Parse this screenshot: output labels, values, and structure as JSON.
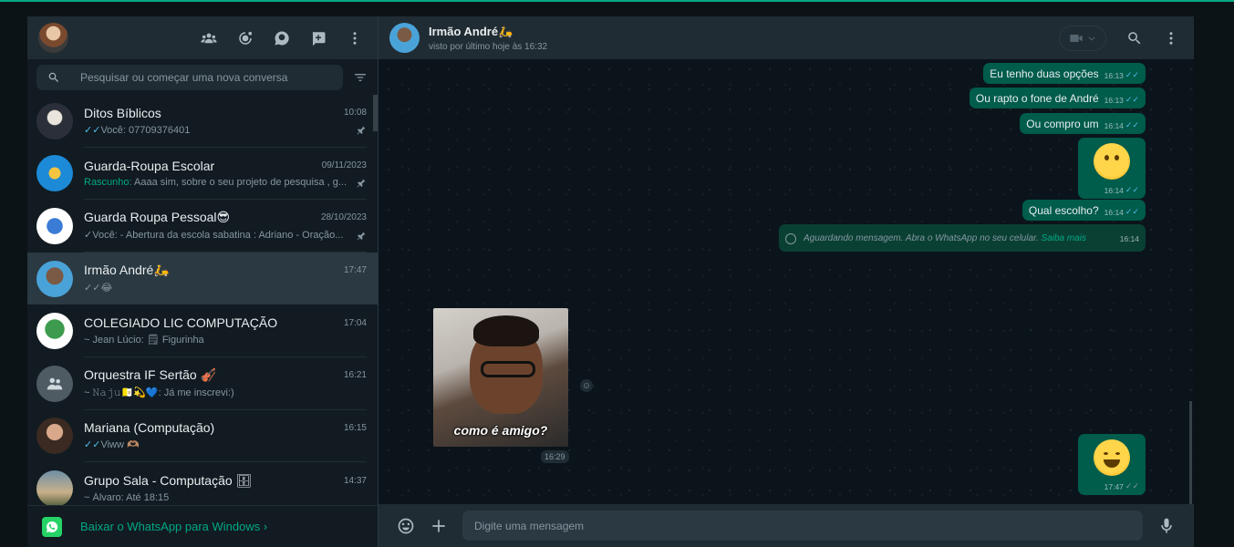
{
  "sidebar": {
    "search_placeholder": "Pesquisar ou começar uma nova conversa",
    "chats": [
      {
        "name": "Ditos Bíblicos",
        "time": "10:08",
        "prefix": "✓✓",
        "preview": "Você: 07709376401",
        "pinned": true
      },
      {
        "name": "Guarda-Roupa Escolar",
        "time": "09/11/2023",
        "draft": "Rascunho:",
        "preview": " Aaaa sim, sobre o seu projeto de pesquisa , g...",
        "pinned": true
      },
      {
        "name": "Guarda Roupa Pessoal😎",
        "time": "28/10/2023",
        "prefix": "✓",
        "preview": "Você: - Abertura da escola sabatina : Adriano - Oração...",
        "pinned": true
      },
      {
        "name": "Irmão André🛵",
        "time": "17:47",
        "prefix": "✓✓",
        "preview": "😂"
      },
      {
        "name": "COLEGIADO LIC COMPUTAÇÃO",
        "time": "17:04",
        "preview": "~ Jean Lúcio: 🗒 Figurinha"
      },
      {
        "name": "Orquestra IF Sertão 🎻",
        "time": "16:21",
        "preview": "~ 𝙽𝚊𝚓𝚞🇻🇦💫💙: Já me inscrevi:)"
      },
      {
        "name": "Mariana (Computação)",
        "time": "16:15",
        "prefix": "✓✓",
        "preview": "Viww 🫶🏽"
      },
      {
        "name": "Grupo Sala - Computação 🗄",
        "time": "14:37",
        "preview": "~ Álvaro: Até 18:15"
      }
    ],
    "banner": "Baixar o WhatsApp para Windows ›"
  },
  "chat": {
    "name": "Irmão André🛵",
    "status": "visto por último hoje às 16:32",
    "messages": [
      {
        "text": "Eu tenho duas opções",
        "time": "16:13"
      },
      {
        "text": "Ou rapto o fone de André",
        "time": "16:13"
      },
      {
        "text": "Ou compro um",
        "time": "16:14"
      },
      {
        "emoji": "🤔",
        "time": "16:14"
      },
      {
        "text": "Qual escolho?",
        "time": "16:14"
      },
      {
        "pending": "Aguardando mensagem. Abra o WhatsApp no seu celular.",
        "link": "Saiba mais",
        "time": "16:14"
      },
      {
        "emoji": "😂",
        "time": "17:47"
      }
    ],
    "sticker": {
      "caption": "como é amigo?",
      "time": "16:29"
    },
    "input_placeholder": "Digite uma mensagem"
  },
  "ticks": "✓✓",
  "colors": {
    "accent": "#00a884",
    "outgoing": "#005c4b",
    "panel": "#202c33",
    "background": "#111b21"
  }
}
